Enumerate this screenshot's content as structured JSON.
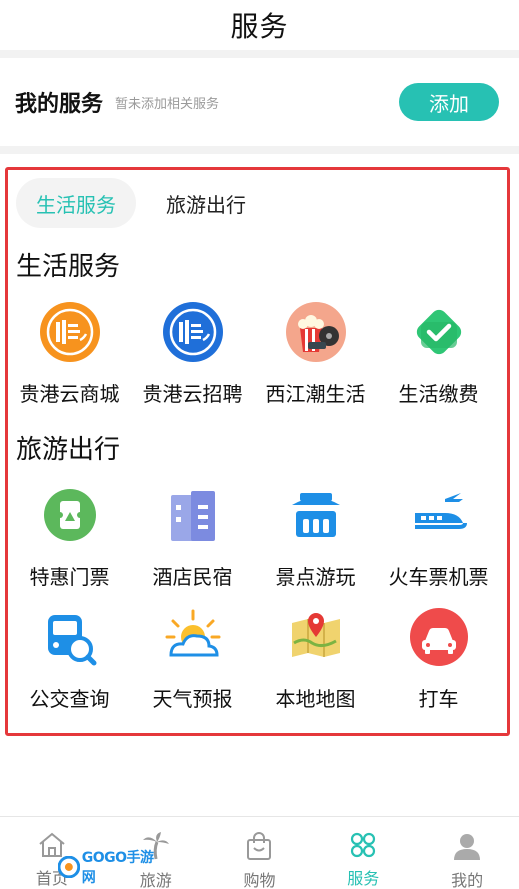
{
  "header": {
    "title": "服务"
  },
  "my_services": {
    "heading": "我的服务",
    "hint": "暂未添加相关服务",
    "add_label": "添加"
  },
  "tabs": [
    {
      "label": "生活服务",
      "active": true
    },
    {
      "label": "旅游出行",
      "active": false
    }
  ],
  "sections": [
    {
      "title": "生活服务",
      "items": [
        {
          "label": "贵港云商城",
          "icon": "guigang-cloud-mall-icon"
        },
        {
          "label": "贵港云招聘",
          "icon": "guigang-cloud-recruit-icon"
        },
        {
          "label": "西江潮生活",
          "icon": "popcorn-film-icon"
        },
        {
          "label": "生活缴费",
          "icon": "checkmark-shield-icon"
        }
      ]
    },
    {
      "title": "旅游出行",
      "items": [
        {
          "label": "特惠门票",
          "icon": "ticket-icon"
        },
        {
          "label": "酒店民宿",
          "icon": "hotel-building-icon"
        },
        {
          "label": "景点游玩",
          "icon": "scenic-pavilion-icon"
        },
        {
          "label": "火车票机票",
          "icon": "train-plane-icon"
        },
        {
          "label": "公交查询",
          "icon": "bus-search-icon"
        },
        {
          "label": "天气预报",
          "icon": "sun-cloud-icon"
        },
        {
          "label": "本地地图",
          "icon": "map-pin-icon"
        },
        {
          "label": "打车",
          "icon": "taxi-car-icon"
        }
      ]
    }
  ],
  "bottom_nav": [
    {
      "label": "首页",
      "icon": "home-icon"
    },
    {
      "label": "旅游",
      "icon": "palm-tree-icon"
    },
    {
      "label": "购物",
      "icon": "shopping-bag-icon"
    },
    {
      "label": "服务",
      "icon": "service-clover-icon",
      "active": true
    },
    {
      "label": "我的",
      "icon": "user-icon"
    }
  ],
  "watermark": {
    "text": "GOGO手游网"
  },
  "colors": {
    "accent": "#27c1b3",
    "highlight_border": "#e5383b",
    "divider": "#f2f2f2"
  }
}
